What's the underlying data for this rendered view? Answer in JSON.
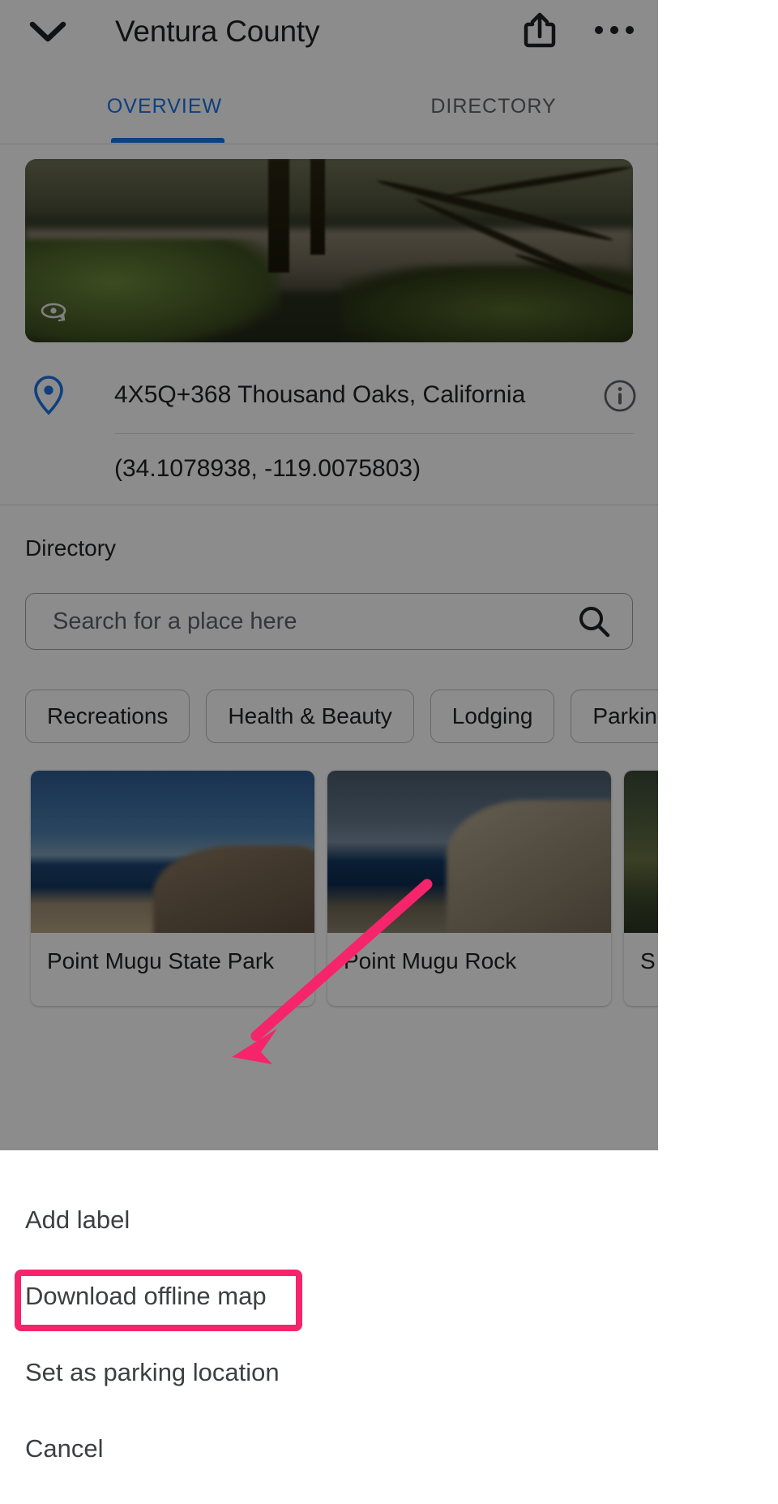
{
  "header": {
    "title": "Ventura County",
    "collapse_icon": "chevron-down-icon",
    "share_icon": "share-icon",
    "more_icon": "overflow-menu-icon"
  },
  "tabs": [
    {
      "label": "OVERVIEW",
      "selected": true
    },
    {
      "label": "DIRECTORY",
      "selected": false
    }
  ],
  "hero": {
    "pano_icon": "street-view-icon"
  },
  "place": {
    "pin_icon": "location-pin-icon",
    "address": "4X5Q+368 Thousand Oaks, California",
    "info_icon": "info-icon",
    "coordinates": "(34.1078938, -119.0075803)"
  },
  "directory": {
    "heading": "Directory",
    "search": {
      "placeholder": "Search for a place here",
      "value": "",
      "icon": "search-icon"
    },
    "chips": [
      {
        "label": "Recreations"
      },
      {
        "label": "Health & Beauty"
      },
      {
        "label": "Lodging"
      },
      {
        "label": "Parking"
      }
    ],
    "cards": [
      {
        "name": "Point Mugu State Park"
      },
      {
        "name": "Point Mugu Rock"
      },
      {
        "name": "S"
      }
    ]
  },
  "bottom_sheet": {
    "items": [
      {
        "label": "Add label",
        "highlighted": false
      },
      {
        "label": "Download offline map",
        "highlighted": true
      },
      {
        "label": "Set as parking location",
        "highlighted": false
      },
      {
        "label": "Cancel",
        "highlighted": false
      }
    ]
  },
  "annotation": {
    "highlight_color": "#f6246b",
    "target_label": "Download offline map"
  },
  "colors": {
    "accent": "#1a73e8",
    "text_primary": "#202124",
    "text_secondary": "#5f6368",
    "annotation": "#f6246b",
    "scrim": "rgba(0,0,0,0.45)"
  }
}
